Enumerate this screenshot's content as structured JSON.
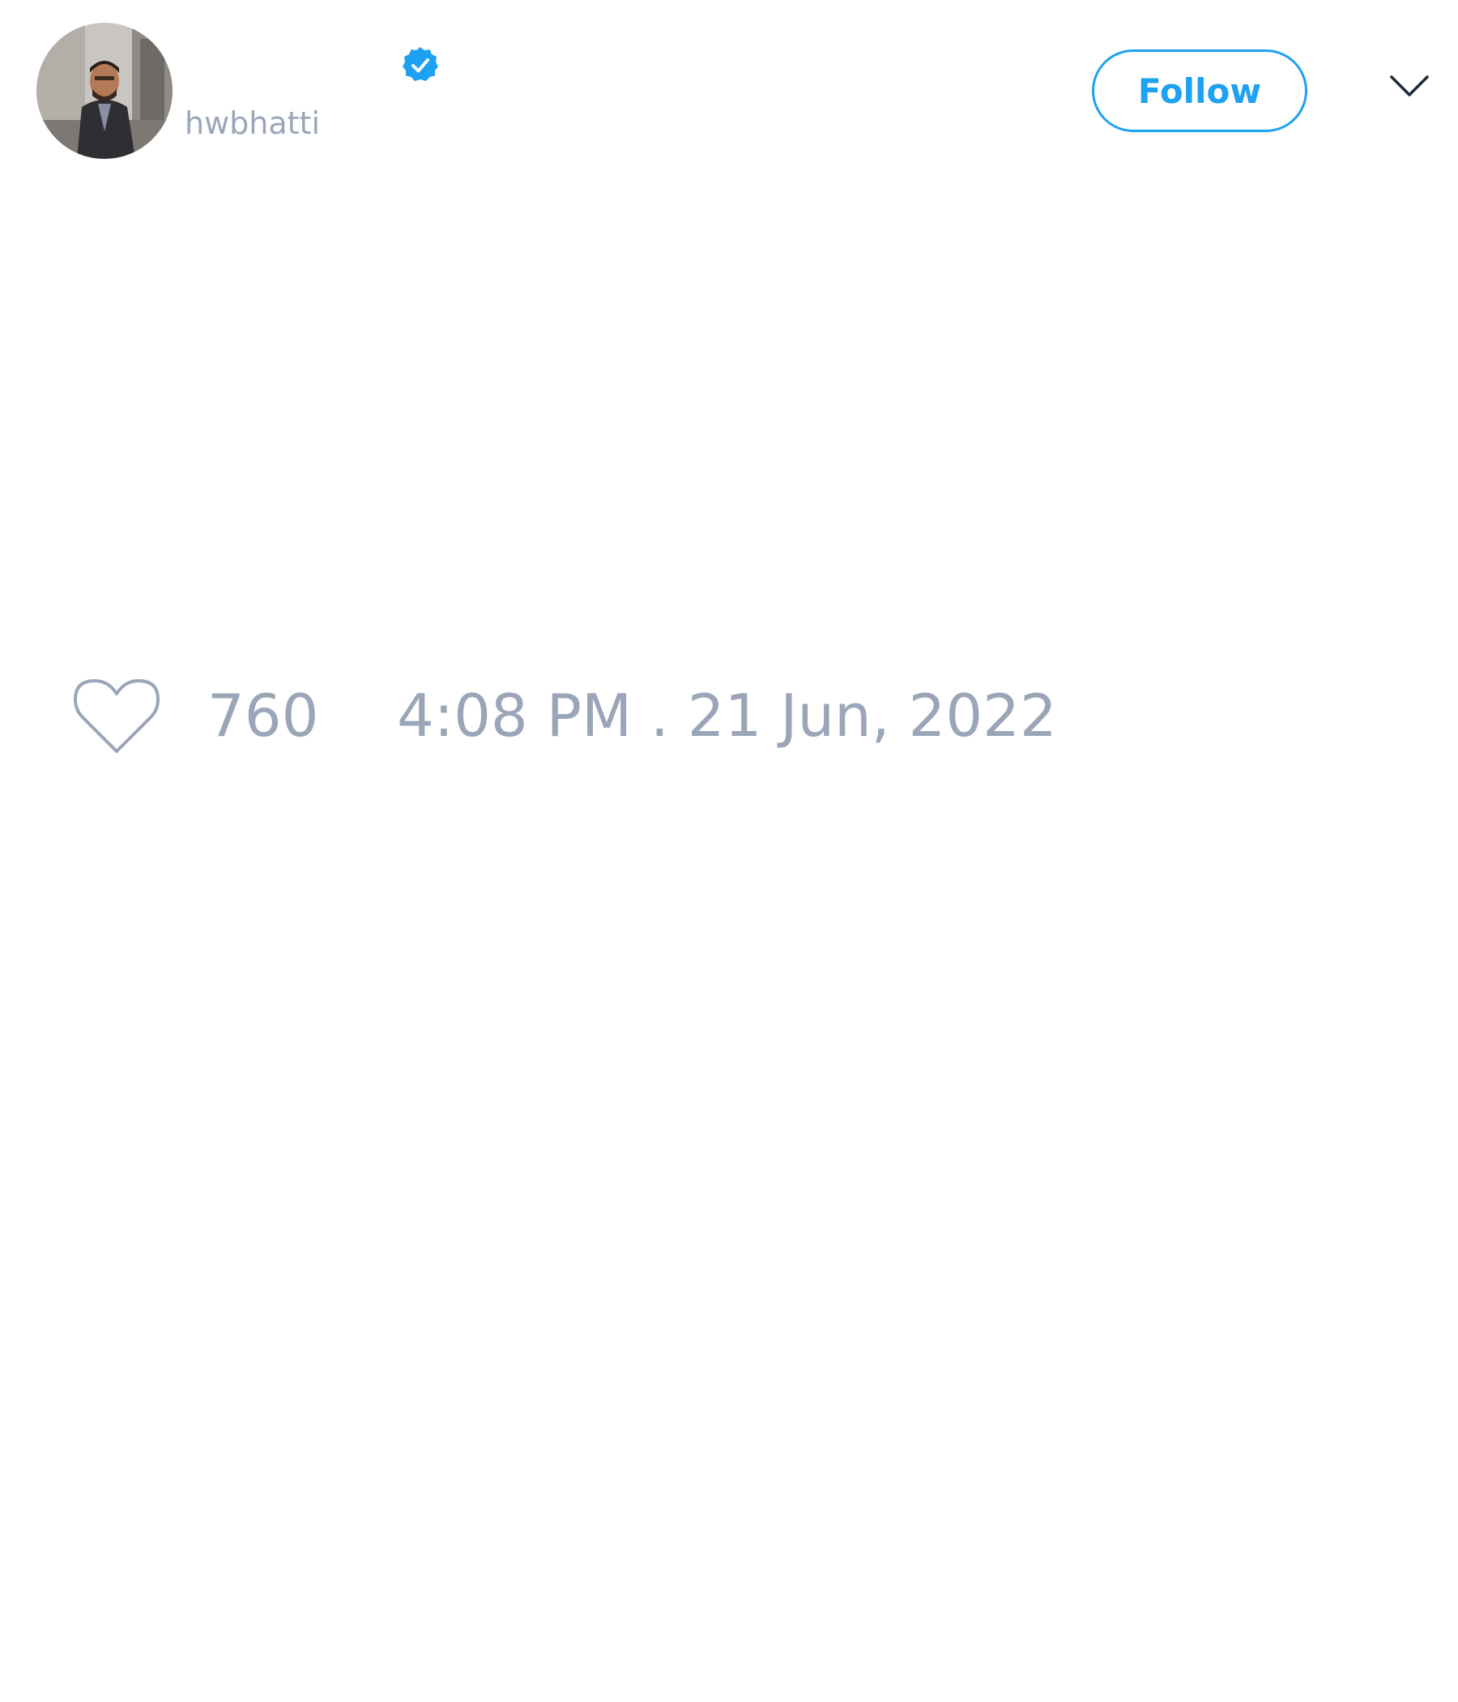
{
  "author": {
    "display_name": "",
    "handle": "hwbhatti",
    "verified": true,
    "avatar_icon": "profile-photo-avatar"
  },
  "header": {
    "follow_label": "Follow",
    "menu_icon": "chevron-down-icon"
  },
  "engagement": {
    "like_icon": "heart-outline-icon",
    "like_count": "760",
    "timestamp": "4:08 PM . 21 Jun, 2022"
  },
  "colors": {
    "accent": "#1da1f2",
    "muted_text": "#9aa6b8",
    "background": "#ffffff"
  }
}
